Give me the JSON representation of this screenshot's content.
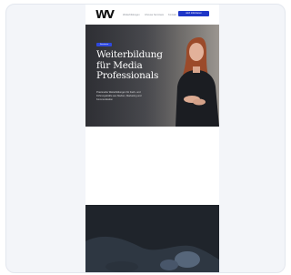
{
  "site": {
    "logo": "WV",
    "nav": {
      "links": [
        "Weiterbildungen",
        "Inhouse Seminare",
        "Kontakt"
      ],
      "cta": "Jetzt informieren"
    },
    "hero": {
      "badge": "Seminare",
      "headline_lines": [
        "Weiterbildung",
        "für Media",
        "Professionals"
      ],
      "subtext": "Praxisnahe Weiterbildungen für Fach- und Führungskräfte aus Medien, Marketing und Kommunikation"
    }
  },
  "colors": {
    "accent": "#1f36c7",
    "badge": "#2f49e0",
    "hero_text": "#ffffff",
    "card_background": "#f3f5f9"
  }
}
